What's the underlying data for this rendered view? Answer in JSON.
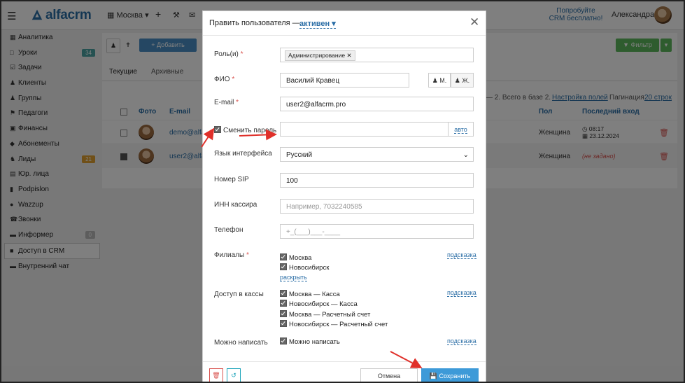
{
  "topbar": {
    "logo_text": "alfacrm",
    "branch": "Москва",
    "try_line1": "Попробуйте",
    "try_line2": "CRM бесплатно!",
    "user_name": "Александра"
  },
  "sidebar": {
    "items": [
      {
        "label": "Аналитика",
        "icon": "chart-icon"
      },
      {
        "label": "Уроки",
        "icon": "calendar-icon",
        "badge": "34"
      },
      {
        "label": "Задачи",
        "icon": "tasks-icon"
      },
      {
        "label": "Клиенты",
        "icon": "user-icon"
      },
      {
        "label": "Группы",
        "icon": "users-icon"
      },
      {
        "label": "Педагоги",
        "icon": "graduation-icon"
      },
      {
        "label": "Финансы",
        "icon": "money-icon"
      },
      {
        "label": "Абонементы",
        "icon": "tag-icon"
      },
      {
        "label": "Лиды",
        "icon": "lead-icon",
        "badge": "21"
      },
      {
        "label": "Юр. лица",
        "icon": "building-icon"
      },
      {
        "label": "Podpislon",
        "icon": "doc-icon"
      },
      {
        "label": "Wazzup",
        "icon": "whatsapp-icon"
      },
      {
        "label": "Звонки",
        "icon": "phone-icon"
      },
      {
        "label": "Информер",
        "icon": "informer-icon",
        "badge": "0"
      },
      {
        "label": "Доступ в CRM",
        "icon": "lock-icon",
        "active": true
      },
      {
        "label": "Внутренний чат",
        "icon": "chat-icon"
      }
    ]
  },
  "main": {
    "add_button": "+ Добавить",
    "filter_button": "Фильтр",
    "tabs": [
      "Текущие",
      "Архивные"
    ],
    "summary": "— 2. Всего в базе 2.",
    "fields_link": "Настройка полей",
    "pagination_label": "Пагинация",
    "pagination_link": "20 строк",
    "columns": {
      "photo": "Фото",
      "email": "E-mail",
      "gender": "Пол",
      "last_login": "Последний вход"
    },
    "rows": [
      {
        "email": "demo@alfac",
        "gender": "Женщина",
        "time": "08:17",
        "date": "23.12.2024"
      },
      {
        "email": "user2@alfac",
        "gender": "Женщина",
        "not_set": "(не задано)"
      }
    ]
  },
  "modal": {
    "title": "Править пользователя —",
    "status": "активен",
    "roles_label": "Роль(и)",
    "roles_chip": "Администрирование",
    "fio_label": "ФИО",
    "fio_value": "Василий Кравец",
    "gender_m": "М.",
    "gender_f": "Ж.",
    "email_label": "E-mail",
    "email_value": "user2@alfacrm.pro",
    "change_password_label": "Сменить пароль",
    "auto_link": "авто",
    "language_label": "Язык интерфейса",
    "language_value": "Русский",
    "sip_label": "Номер SIP",
    "sip_value": "100",
    "inn_label": "ИНН кассира",
    "inn_placeholder": "Например, 7032240585",
    "phone_label": "Телефон",
    "phone_placeholder": "+_(___)___-____",
    "branches_label": "Филиалы",
    "branches": [
      "Москва",
      "Новосибирск"
    ],
    "expand_link": "раскрыть",
    "cash_label": "Доступ в кассы",
    "cash": [
      "Москва — Касса",
      "Новосибирск — Касса",
      "Москва — Расчетный счет",
      "Новосибирск — Расчетный счет"
    ],
    "write_label": "Можно написать",
    "write_option": "Можно написать",
    "hint_link": "подсказка",
    "cancel_button": "Отмена",
    "save_button": "Сохранить"
  },
  "colors": {
    "primary": "#2b6ea6",
    "save": "#3d9ad8",
    "add": "#4a8fc7",
    "filter": "#5cb85c",
    "danger": "#d9534f",
    "arrow": "#e0302a"
  }
}
